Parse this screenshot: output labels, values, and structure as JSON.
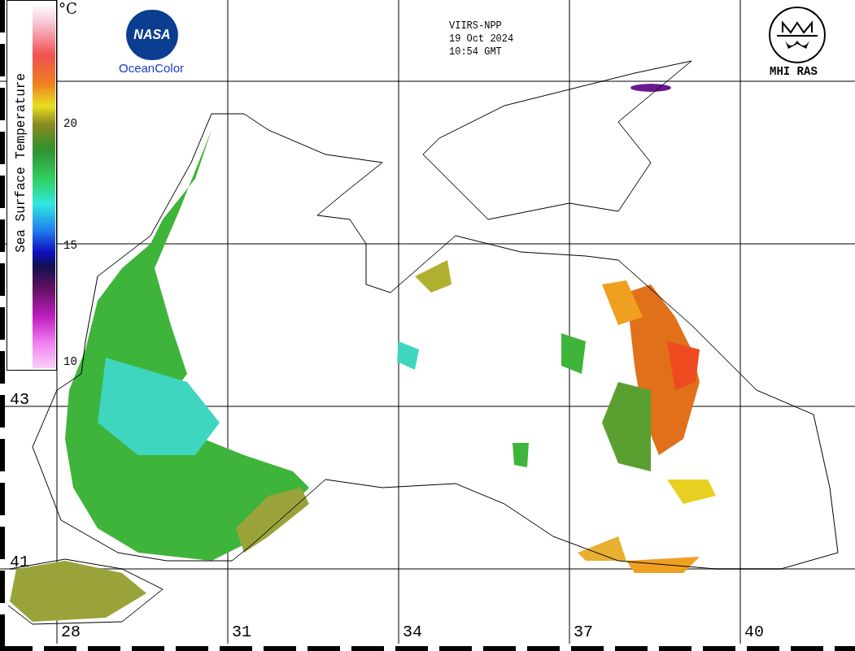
{
  "legend": {
    "unit": "°C",
    "title": "Sea Surface Temperature",
    "ticks": [
      "20",
      "15",
      "10"
    ]
  },
  "header": {
    "sensor": "VIIRS-NPP",
    "date": "19 Oct 2024",
    "time": "10:54 GMT"
  },
  "logos": {
    "agency": "NASA",
    "agency_caption": "OceanColor",
    "institute": "MHI RAS"
  },
  "latitude_labels": [
    "43",
    "41"
  ],
  "longitude_labels": [
    "28",
    "31",
    "34",
    "37",
    "40"
  ]
}
